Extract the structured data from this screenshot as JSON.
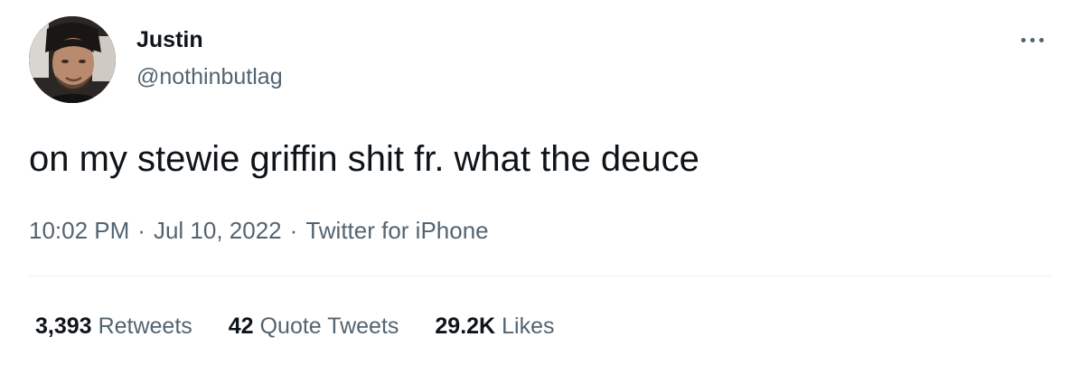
{
  "author": {
    "display_name": "Justin",
    "handle": "@nothinbutlag"
  },
  "tweet": {
    "text": "on my stewie griffin shit fr. what the deuce",
    "time": "10:02 PM",
    "date": "Jul 10, 2022",
    "source": "Twitter for iPhone",
    "separator": "·"
  },
  "stats": [
    {
      "count": "3,393",
      "label": "Retweets"
    },
    {
      "count": "42",
      "label": "Quote Tweets"
    },
    {
      "count": "29.2K",
      "label": "Likes"
    }
  ],
  "icons": {
    "more": "more-horizontal-icon"
  },
  "colors": {
    "primary_text": "#0f1419",
    "secondary_text": "#536471",
    "divider": "#eff3f4"
  }
}
